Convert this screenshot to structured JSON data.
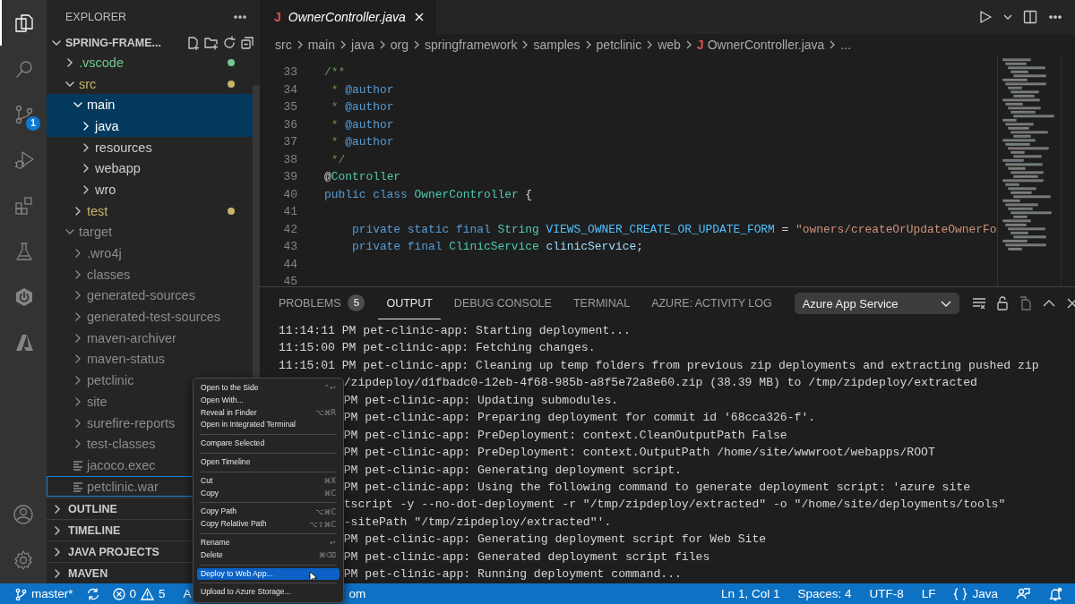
{
  "activity_bar": {
    "items": [
      {
        "kind": "files",
        "selected": true
      },
      {
        "kind": "search",
        "selected": false
      },
      {
        "kind": "source-control",
        "selected": false,
        "badge": "1"
      },
      {
        "kind": "run-debug",
        "selected": false
      },
      {
        "kind": "extensions",
        "selected": false
      },
      {
        "kind": "testing",
        "selected": false
      },
      {
        "kind": "power",
        "selected": false
      },
      {
        "kind": "azure",
        "selected": false
      }
    ],
    "bottom": [
      {
        "kind": "account"
      },
      {
        "kind": "settings"
      }
    ]
  },
  "sidebar": {
    "title": "EXPLORER",
    "folder": "SPRING-FRAME...",
    "tree": [
      {
        "kind": "folder",
        "label": ".vscode",
        "expanded": false,
        "color": "#73c991",
        "selected": false
      },
      {
        "kind": "folder",
        "label": "src",
        "expanded": true,
        "color": "#c9b46a",
        "selected": false,
        "children": [
          {
            "kind": "folder",
            "label": "main",
            "expanded": true,
            "selected": true,
            "children": [
              {
                "kind": "folder",
                "label": "java",
                "expanded": false,
                "selected": true
              },
              {
                "kind": "folder",
                "label": "resources",
                "expanded": false,
                "selected": false
              },
              {
                "kind": "folder",
                "label": "webapp",
                "expanded": false,
                "selected": false
              },
              {
                "kind": "folder",
                "label": "wro",
                "expanded": false,
                "selected": false
              }
            ]
          },
          {
            "kind": "folder",
            "label": "test",
            "expanded": false,
            "color": "#c9b46a",
            "selected": false
          }
        ]
      },
      {
        "kind": "folder",
        "label": "target",
        "expanded": true,
        "dimmed": true,
        "selected": false,
        "children": [
          {
            "kind": "folder",
            "label": ".wro4j",
            "expanded": false,
            "dimmed": true,
            "selected": false
          },
          {
            "kind": "folder",
            "label": "classes",
            "expanded": false,
            "dimmed": true,
            "selected": false
          },
          {
            "kind": "folder",
            "label": "generated-sources",
            "expanded": false,
            "dimmed": true,
            "selected": false
          },
          {
            "kind": "folder",
            "label": "generated-test-sources",
            "expanded": false,
            "dimmed": true,
            "selected": false
          },
          {
            "kind": "folder",
            "label": "maven-archiver",
            "expanded": false,
            "dimmed": true,
            "selected": false
          },
          {
            "kind": "folder",
            "label": "maven-status",
            "expanded": false,
            "dimmed": true,
            "selected": false
          },
          {
            "kind": "folder",
            "label": "petclinic",
            "expanded": false,
            "dimmed": true,
            "selected": false
          },
          {
            "kind": "folder",
            "label": "site",
            "expanded": false,
            "dimmed": true,
            "selected": false
          },
          {
            "kind": "folder",
            "label": "surefire-reports",
            "expanded": false,
            "dimmed": true,
            "selected": false
          },
          {
            "kind": "folder",
            "label": "test-classes",
            "expanded": false,
            "dimmed": true,
            "selected": false
          },
          {
            "kind": "file",
            "label": "jacoco.exec",
            "dimmed": true,
            "selected": false
          },
          {
            "kind": "file",
            "label": "petclinic.war",
            "dimmed": true,
            "selected": false,
            "focused": true
          }
        ]
      }
    ],
    "sections": [
      {
        "label": "OUTLINE",
        "expanded": false
      },
      {
        "label": "TIMELINE",
        "expanded": false
      },
      {
        "label": "JAVA PROJECTS",
        "expanded": false
      },
      {
        "label": "MAVEN",
        "expanded": false
      }
    ]
  },
  "editor": {
    "tabs": [
      {
        "icon": "J",
        "label": "OwnerController.java",
        "selected": true
      }
    ],
    "breadcrumbs": [
      {
        "label": "src"
      },
      {
        "label": "main"
      },
      {
        "label": "java"
      },
      {
        "label": "org"
      },
      {
        "label": "springframework"
      },
      {
        "label": "samples"
      },
      {
        "label": "petclinic"
      },
      {
        "label": "web"
      },
      {
        "label": "OwnerController.java",
        "icon": "J"
      },
      {
        "label": "..."
      }
    ],
    "lines": [
      {
        "number": "33",
        "tokens": [
          {
            "kind": "comment",
            "text": "/**"
          }
        ]
      },
      {
        "number": "34",
        "tokens": [
          {
            "kind": "comment",
            "text": " * "
          },
          {
            "kind": "tag",
            "text": "@author"
          }
        ]
      },
      {
        "number": "35",
        "tokens": [
          {
            "kind": "comment",
            "text": " * "
          },
          {
            "kind": "tag",
            "text": "@author"
          }
        ]
      },
      {
        "number": "36",
        "tokens": [
          {
            "kind": "comment",
            "text": " * "
          },
          {
            "kind": "tag",
            "text": "@author"
          }
        ]
      },
      {
        "number": "37",
        "tokens": [
          {
            "kind": "comment",
            "text": " * "
          },
          {
            "kind": "tag",
            "text": "@author"
          }
        ]
      },
      {
        "number": "38",
        "tokens": [
          {
            "kind": "comment",
            "text": " */"
          }
        ]
      },
      {
        "number": "39",
        "tokens": [
          {
            "kind": "plain",
            "text": "@"
          },
          {
            "kind": "type",
            "text": "Controller"
          }
        ]
      },
      {
        "number": "40",
        "tokens": [
          {
            "kind": "keyword",
            "text": "public class "
          },
          {
            "kind": "type",
            "text": "OwnerController"
          },
          {
            "kind": "plain",
            "text": " {"
          }
        ]
      },
      {
        "number": "41"
      },
      {
        "number": "42",
        "tokens": [
          {
            "kind": "keyword",
            "text": "    private static final "
          },
          {
            "kind": "type",
            "text": "String "
          },
          {
            "kind": "constant",
            "text": "VIEWS_OWNER_CREATE_OR_UPDATE_FORM "
          },
          {
            "kind": "plain",
            "text": "= "
          },
          {
            "kind": "string",
            "text": "\"owners/createOrUpdateOwnerFo"
          }
        ]
      },
      {
        "number": "43",
        "tokens": [
          {
            "kind": "keyword",
            "text": "    private final "
          },
          {
            "kind": "type",
            "text": "ClinicService "
          },
          {
            "kind": "variable",
            "text": "clinicService"
          },
          {
            "kind": "plain",
            "text": ";"
          }
        ]
      },
      {
        "number": "44"
      },
      {
        "number": "45"
      }
    ]
  },
  "panel": {
    "tabs": [
      {
        "label": "PROBLEMS",
        "badge": "5",
        "selected": false
      },
      {
        "label": "OUTPUT",
        "selected": true
      },
      {
        "label": "DEBUG CONSOLE",
        "selected": false
      },
      {
        "label": "TERMINAL",
        "selected": false
      },
      {
        "label": "AZURE: ACTIVITY LOG",
        "selected": false
      }
    ],
    "channel": "Azure App Service",
    "output": [
      {
        "kind": "full",
        "text": "11:14:11 PM pet-clinic-app: Starting deployment..."
      },
      {
        "kind": "full",
        "text": "11:15:00 PM pet-clinic-app: Fetching changes."
      },
      {
        "kind": "full",
        "text": "11:15:01 PM pet-clinic-app: Cleaning up temp folders from previous zip deployments and extracting pushed zip"
      },
      {
        "kind": "covered",
        "text": "/zipdeploy/d1fbadc0-12eb-4f68-985b-a8f5e72a8e60.zip (38.39 MB) to /tmp/zipdeploy/extracted"
      },
      {
        "kind": "covered",
        "text": "PM pet-clinic-app: Updating submodules."
      },
      {
        "kind": "covered",
        "text": "PM pet-clinic-app: Preparing deployment for commit id '68cca326-f'."
      },
      {
        "kind": "covered",
        "text": "PM pet-clinic-app: PreDeployment: context.CleanOutputPath False"
      },
      {
        "kind": "covered",
        "text": "PM pet-clinic-app: PreDeployment: context.OutputPath /home/site/wwwroot/webapps/ROOT"
      },
      {
        "kind": "covered",
        "text": "PM pet-clinic-app: Generating deployment script."
      },
      {
        "kind": "covered",
        "text": "PM pet-clinic-app: Using the following command to generate deployment script: 'azure site"
      },
      {
        "kind": "covered",
        "text": "tscript -y --no-dot-deployment -r \"/tmp/zipdeploy/extracted\" -o \"/home/site/deployments/tools\""
      },
      {
        "kind": "covered",
        "text": "-sitePath \"/tmp/zipdeploy/extracted\"'."
      },
      {
        "kind": "covered",
        "text": "PM pet-clinic-app: Generating deployment script for Web Site"
      },
      {
        "kind": "covered",
        "text": "PM pet-clinic-app: Generated deployment script files"
      },
      {
        "kind": "covered",
        "text": "PM pet-clinic-app: Running deployment command..."
      }
    ]
  },
  "context_menu": {
    "groups": [
      {
        "items": [
          {
            "label": "Open to the Side",
            "shortcut": "⌃↩",
            "selected": false
          },
          {
            "label": "Open With...",
            "selected": false
          },
          {
            "label": "Reveal in Finder",
            "shortcut": "⌥⌘R",
            "selected": false
          },
          {
            "label": "Open in Integrated Terminal",
            "selected": false
          }
        ]
      },
      {
        "items": [
          {
            "label": "Compare Selected",
            "selected": false
          }
        ]
      },
      {
        "items": [
          {
            "label": "Open Timeline",
            "selected": false
          }
        ]
      },
      {
        "items": [
          {
            "label": "Cut",
            "shortcut": "⌘X",
            "selected": false
          },
          {
            "label": "Copy",
            "shortcut": "⌘C",
            "selected": false
          }
        ]
      },
      {
        "items": [
          {
            "label": "Copy Path",
            "shortcut": "⌥⌘C",
            "selected": false
          },
          {
            "label": "Copy Relative Path",
            "shortcut": "⌥⇧⌘C",
            "selected": false
          }
        ]
      },
      {
        "items": [
          {
            "label": "Rename",
            "shortcut": "↩",
            "selected": false
          },
          {
            "label": "Delete",
            "shortcut": "⌘⌫",
            "selected": false
          }
        ]
      },
      {
        "items": [
          {
            "label": "Deploy to Web App...",
            "selected": true
          }
        ]
      },
      {
        "items": [
          {
            "label": "Upload to Azure Storage...",
            "selected": false
          }
        ]
      }
    ]
  },
  "status_bar": {
    "branch": "master*",
    "errors": "0",
    "warnings": "5",
    "fragment_before": "A",
    "fragment_after": "om",
    "right": [
      {
        "kind": "text",
        "text": "Ln 1, Col 1"
      },
      {
        "kind": "text",
        "text": "Spaces: 4"
      },
      {
        "kind": "text",
        "text": "UTF-8"
      },
      {
        "kind": "text",
        "text": "LF"
      },
      {
        "kind": "language",
        "text": "Java"
      },
      {
        "kind": "feedback"
      },
      {
        "kind": "bell"
      }
    ]
  }
}
